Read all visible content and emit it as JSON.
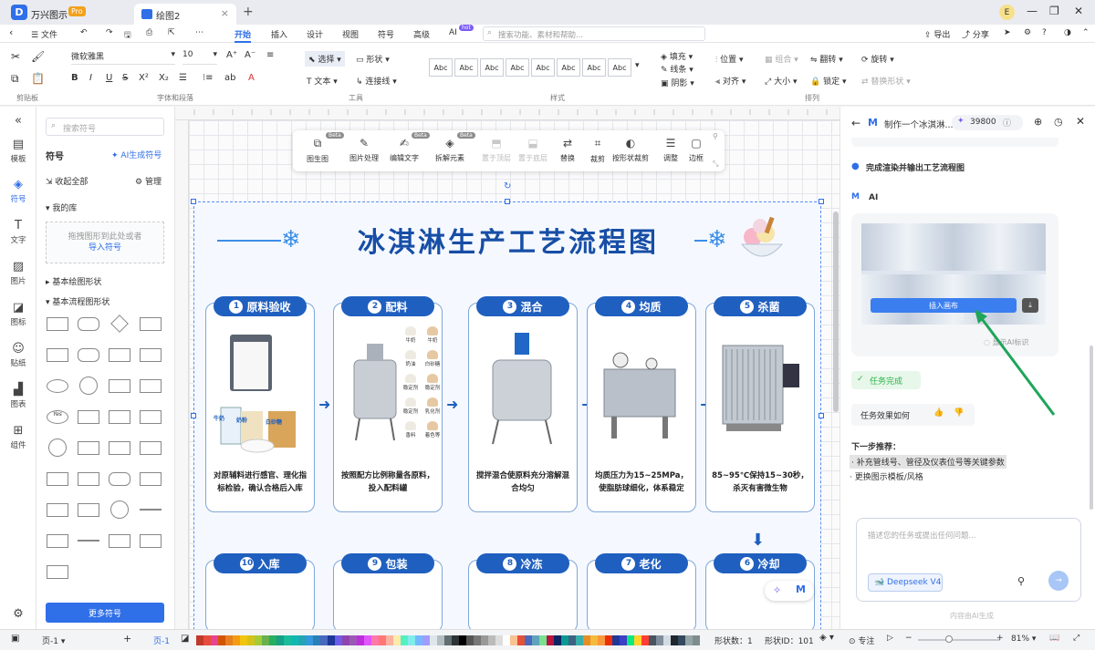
{
  "titlebar": {
    "app_name": "万兴图示",
    "pro_badge": "Pro",
    "doc_tab": "绘图2",
    "user_initial": "E"
  },
  "menu": {
    "file": "文件",
    "tabs": [
      "开始",
      "插入",
      "设计",
      "视图",
      "符号",
      "高级",
      "AI"
    ],
    "ai_badge": "hot",
    "search_placeholder": "搜索功能、素材和帮助...",
    "export": "导出",
    "share": "分享"
  },
  "ribbon": {
    "clipboard_label": "剪贴板",
    "font_label": "字体和段落",
    "tools_label": "工具",
    "style_label": "样式",
    "arrange_label": "排列",
    "font_name": "微软雅黑",
    "font_size": "10",
    "select": "选择",
    "shape": "形状",
    "text": "文本",
    "connector": "连接线",
    "fill": "填充",
    "line": "线条",
    "shadow": "阴影",
    "position": "位置",
    "group": "组合",
    "flip": "翻转",
    "rotate": "旋转",
    "align": "对齐",
    "size": "大小",
    "lock": "锁定",
    "replace_shape": "替换形状",
    "style_sample": "Abc"
  },
  "leftnav": {
    "items": [
      "模板",
      "符号",
      "文字",
      "图片",
      "图标",
      "贴纸",
      "图表",
      "组件"
    ]
  },
  "symbols": {
    "search_placeholder": "搜索符号",
    "title": "符号",
    "ai_gen": "AI生成符号",
    "collapse_all": "收起全部",
    "manage": "管理",
    "my_library": "我的库",
    "drop_hint": "拖拽图形到此处或者",
    "import": "导入符号",
    "basic_shapes": "基本绘图形状",
    "basic_flow": "基本流程图形状",
    "more": "更多符号",
    "yes_label": "Yes"
  },
  "floatbar": {
    "items": [
      "图生图",
      "图片处理",
      "编辑文字",
      "拆解元素",
      "置于顶层",
      "置于底层",
      "替换",
      "裁剪",
      "按形状裁剪",
      "调整",
      "边框"
    ],
    "beta": "Beta"
  },
  "poster": {
    "title": "冰淇淋生产工艺流程图",
    "steps": [
      {
        "num": "1",
        "name": "原料验收",
        "desc": "对原辅料进行感官、理化指标检验，确认合格后入库"
      },
      {
        "num": "2",
        "name": "配料",
        "desc": "按照配方比例称量各原料，投入配料罐"
      },
      {
        "num": "3",
        "name": "混合",
        "desc": "搅拌混合使原料充分溶解混合均匀"
      },
      {
        "num": "4",
        "name": "均质",
        "desc": "均质压力为15~25MPa，使脂肪球细化，体系稳定"
      },
      {
        "num": "5",
        "name": "杀菌",
        "desc": "85~95℃保持15~30秒，杀灭有害微生物"
      }
    ],
    "bottom_steps": [
      {
        "num": "10",
        "name": "入库"
      },
      {
        "num": "9",
        "name": "包装"
      },
      {
        "num": "8",
        "name": "冷冻"
      },
      {
        "num": "7",
        "name": "老化"
      },
      {
        "num": "6",
        "name": "冷却"
      }
    ],
    "ingredients": [
      "牛奶",
      "牛奶",
      "奶油",
      "白砂糖",
      "稳定剂",
      "稳定剂",
      "稳定剂",
      "乳化剂",
      "香料",
      "着色等"
    ],
    "carton_labels": [
      "牛奶",
      "奶粉",
      "白砂糖"
    ]
  },
  "ai_panel": {
    "title": "制作一个冰淇淋...",
    "credits": "39800",
    "done_msg": "完成渲染并输出工艺流程图",
    "ai_label": "AI",
    "insert_canvas": "插入画布",
    "ai_mark": "显示AI标识",
    "task_done": "任务完成",
    "feedback": "任务效果如何",
    "next_title": "下一步推荐：",
    "next_items": [
      "· 补充管线号、管径及仪表位号等关键参数",
      "· 更换图示模板/风格"
    ],
    "input_placeholder": "描述您的任务或提出任何问题...",
    "model": "Deepseek V4",
    "disclaimer": "内容由AI生成"
  },
  "statusbar": {
    "page_select": "页-1",
    "page_tab": "页-1",
    "shape_count": "形状数：1",
    "shape_id": "形状ID：101",
    "focus": "专注",
    "zoom": "81%"
  },
  "colors": {
    "accent": "#2f6fe8",
    "poster_blue": "#1f5fbf",
    "ai_green": "#2db34a"
  }
}
